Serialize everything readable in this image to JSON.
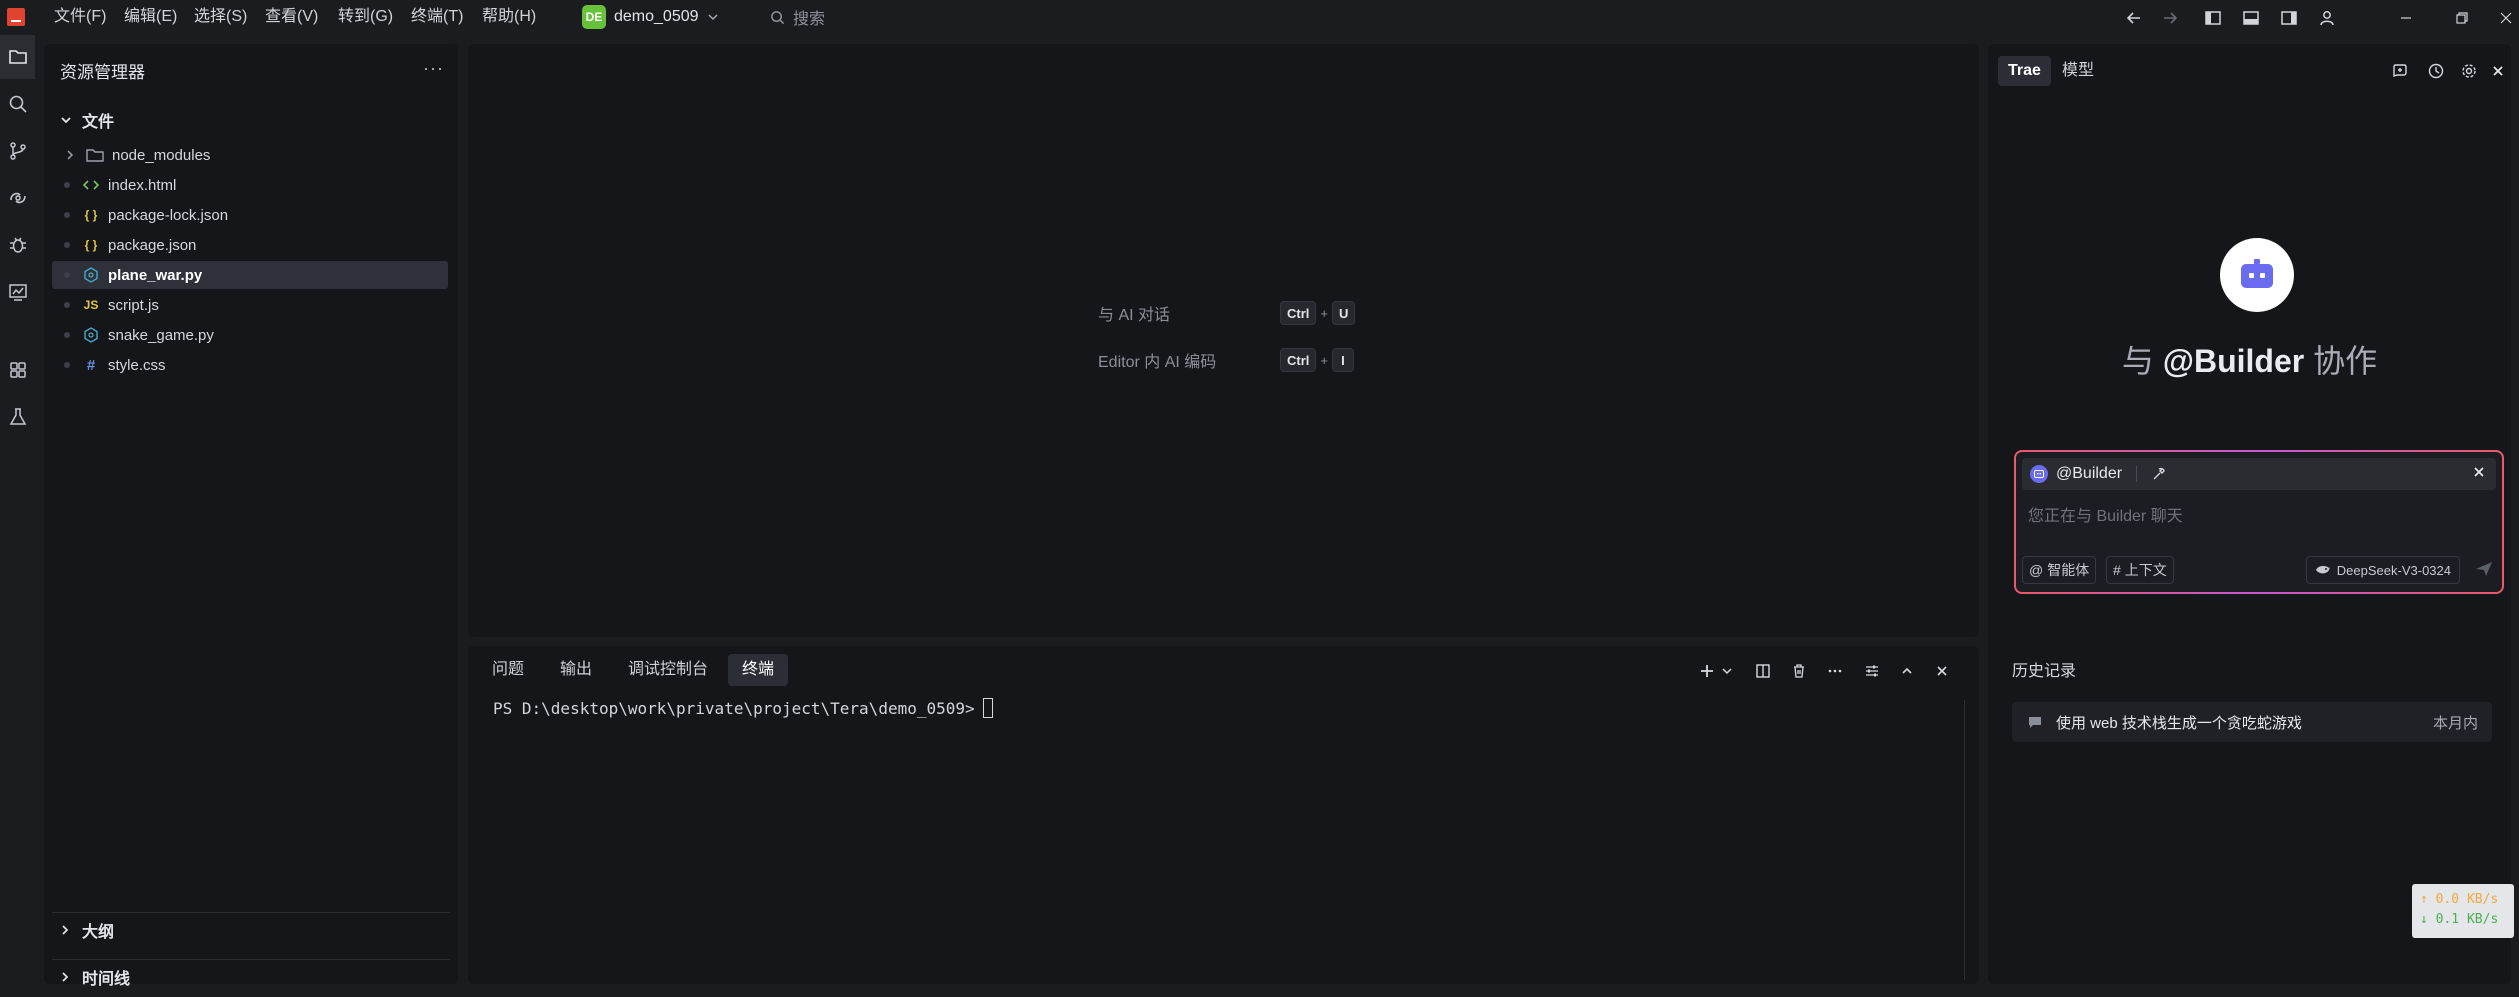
{
  "titlebar": {
    "menus": [
      "文件(F)",
      "编辑(E)",
      "选择(S)",
      "查看(V)",
      "转到(G)",
      "终端(T)",
      "帮助(H)"
    ],
    "project_badge": "DE",
    "project_name": "demo_0509",
    "search_placeholder": "搜索",
    "icons": [
      "back-arrow-icon",
      "forward-arrow-icon",
      "toggle-sidebar-icon",
      "toggle-panel-icon",
      "toggle-secondary-sidebar-icon",
      "account-icon",
      "minimize-icon",
      "restore-icon",
      "close-icon"
    ]
  },
  "activitybar": {
    "items": [
      "files-icon",
      "search-icon",
      "source-control-icon",
      "remote-icon",
      "debug-icon",
      "preview-icon",
      "extensions-icon",
      "testing-icon"
    ]
  },
  "explorer": {
    "title": "资源管理器",
    "more": "···",
    "section_files": "文件",
    "files": [
      {
        "name": "node_modules",
        "type": "folder",
        "icon": "folder-icon",
        "color": "#9da1aa"
      },
      {
        "name": "index.html",
        "type": "html",
        "icon": "html-icon",
        "color": "#7cc35f"
      },
      {
        "name": "package-lock.json",
        "type": "json",
        "icon": "json-icon",
        "color": "#e2c44a"
      },
      {
        "name": "package.json",
        "type": "json",
        "icon": "json-icon",
        "color": "#e2c44a"
      },
      {
        "name": "plane_war.py",
        "type": "python",
        "icon": "python-icon",
        "color": "#46a9c6",
        "selected": true
      },
      {
        "name": "script.js",
        "type": "js",
        "icon": "js-icon",
        "color": "#e2c44a"
      },
      {
        "name": "snake_game.py",
        "type": "python",
        "icon": "python-icon",
        "color": "#46a9c6"
      },
      {
        "name": "style.css",
        "type": "css",
        "icon": "css-icon",
        "color": "#6a8fe0"
      }
    ],
    "section_outline": "大纲",
    "section_timeline": "时间线"
  },
  "editor": {
    "hint_chat_label": "与 AI 对话",
    "hint_chat_keys": [
      "Ctrl",
      "U"
    ],
    "hint_inline_label": "Editor 内 AI 编码",
    "hint_inline_keys": [
      "Ctrl",
      "I"
    ],
    "plus": "+"
  },
  "panel": {
    "tabs": [
      "问题",
      "输出",
      "调试控制台",
      "终端"
    ],
    "active_tab": "终端",
    "terminal_prompt": "PS D:\\desktop\\work\\private\\project\\Tera\\demo_0509>"
  },
  "ai_panel": {
    "tabs": [
      "Trae",
      "模型"
    ],
    "active_tab": "Trae",
    "title_prefix": "与",
    "title_agent": "@Builder",
    "title_suffix": "协作",
    "agent_chip": "@Builder",
    "input_placeholder": "您正在与 Builder 聊天",
    "chip_agents": "智能体",
    "chip_context": "上下文",
    "model": "DeepSeek-V3-0324",
    "history_title": "历史记录",
    "history_items": [
      {
        "title": "使用 web 技术栈生成一个贪吃蛇游戏",
        "time": "本月内"
      }
    ]
  },
  "network": {
    "up": "↑ 0.0 KB/s",
    "down": "↓ 0.1 KB/s"
  },
  "colors": {
    "background": "#1b1c1f",
    "panel": "#15161a",
    "accent_gradient_start": "#e85a6b",
    "accent_gradient_mid": "#c45bd0",
    "bot": "#6a6cf0"
  }
}
